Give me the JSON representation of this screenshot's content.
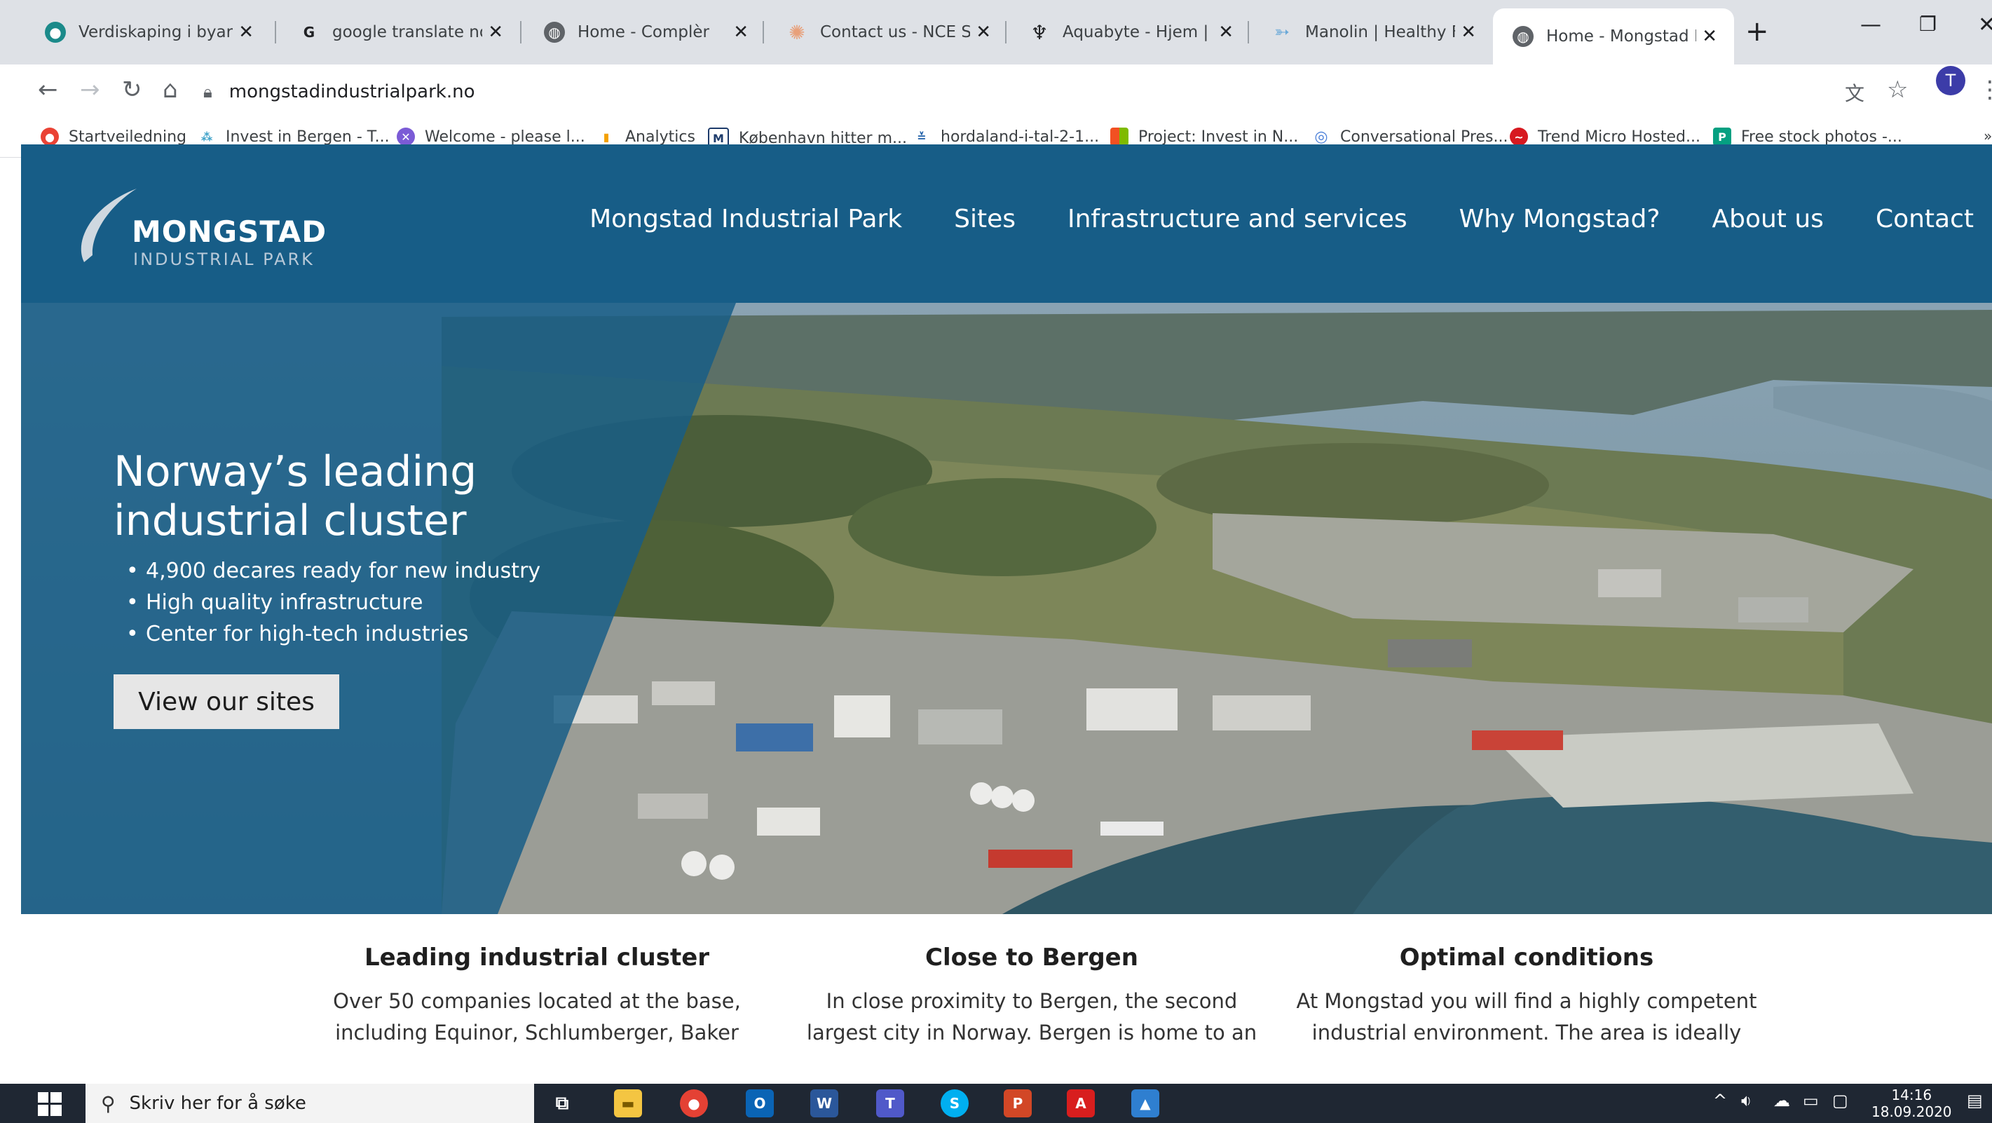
{
  "browser": {
    "tabs": [
      {
        "title": "Verdiskaping i byar og",
        "icon": "globe-colored-icon",
        "color": "#1b8a8a"
      },
      {
        "title": "google translate norsk",
        "icon": "google-g-icon",
        "color": "#4285f4"
      },
      {
        "title": "Home - Complèr",
        "icon": "globe-icon",
        "color": "#5f6368"
      },
      {
        "title": "Contact us - NCE Seafo",
        "icon": "sun-icon",
        "color": "#e8a07a"
      },
      {
        "title": "Aquabyte - Hjem | Aqu",
        "icon": "aquabyte-icon",
        "color": "#202124"
      },
      {
        "title": "Manolin | Healthy Farm",
        "icon": "fish-icon",
        "color": "#6aa9d8"
      },
      {
        "title": "Home - Mongstad Indu",
        "icon": "globe-icon",
        "color": "#5f6368"
      }
    ],
    "active_tab_index": 6,
    "new_tab_symbol": "+",
    "url": "mongstadindustrialpark.no",
    "profile_initial": "T",
    "bookmarks": [
      {
        "label": "Startveiledning",
        "color": "#ea4335"
      },
      {
        "label": "Invest in Bergen - T...",
        "color": "#3aa0c8"
      },
      {
        "label": "Welcome - please l...",
        "color": "#7b5bd6"
      },
      {
        "label": "Analytics",
        "color": "#f4a100"
      },
      {
        "label": "København hitter m...",
        "color": "#1d3b6b"
      },
      {
        "label": "hordaland-i-tal-2-1...",
        "color": "#1f5fa8"
      },
      {
        "label": "Project: Invest in N...",
        "color": "#f25022"
      },
      {
        "label": "Conversational Pres...",
        "color": "#4a7fd8"
      },
      {
        "label": "Trend Micro Hosted...",
        "color": "#d71920"
      },
      {
        "label": "Free stock photos -...",
        "color": "#05a081"
      }
    ]
  },
  "site": {
    "logo": {
      "name": "MONGSTAD",
      "sub": "INDUSTRIAL PARK"
    },
    "nav": [
      "Mongstad Industrial Park",
      "Sites",
      "Infrastructure and services",
      "Why Mongstad?",
      "About us",
      "Contact"
    ],
    "hero": {
      "title_line1": "Norway’s leading",
      "title_line2": "industrial cluster",
      "bullets": [
        "4,900 decares ready for new industry",
        "High quality infrastructure",
        "Center for high-tech industries"
      ],
      "button": "View our sites"
    },
    "features": [
      {
        "title": "Leading industrial cluster",
        "line1": "Over 50 companies located at the base,",
        "line2": "including Equinor, Schlumberger, Baker"
      },
      {
        "title": "Close to Bergen",
        "line1": "In close proximity to Bergen, the second",
        "line2": "largest city in Norway. Bergen is home to an"
      },
      {
        "title": "Optimal conditions",
        "line1": "At Mongstad you will find a highly competent",
        "line2": "industrial environment. The area is ideally"
      }
    ],
    "brand_color": "#175d87"
  },
  "taskbar": {
    "search_placeholder": "Skriv her for å søke",
    "time": "14:16",
    "date": "18.09.2020"
  }
}
